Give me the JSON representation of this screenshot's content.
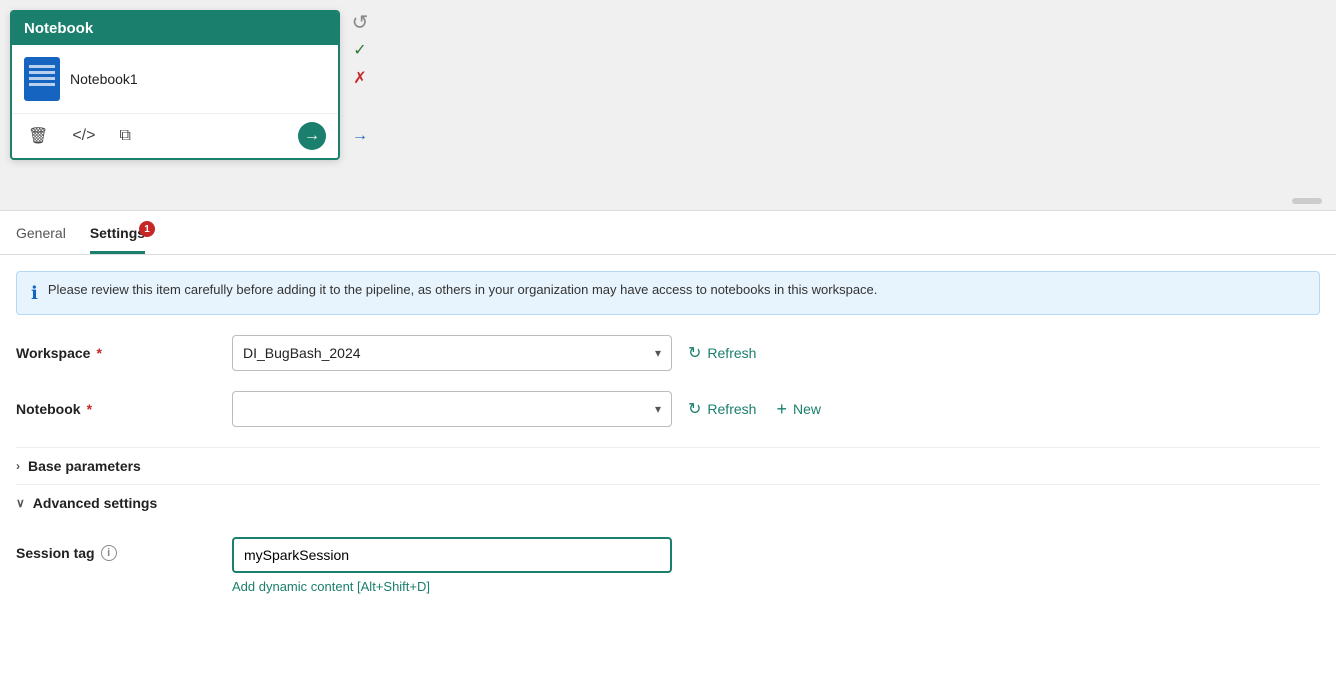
{
  "canvas": {
    "node": {
      "title": "Notebook",
      "name": "Notebook1",
      "actions": {
        "delete_label": "🗑",
        "code_label": "</>",
        "copy_label": "⧉",
        "go_label": "→"
      }
    }
  },
  "sidebar": {
    "undo_icon": "↺",
    "check_icon": "✓",
    "cross_icon": "✗",
    "arrow_right_icon": "→"
  },
  "tabs": {
    "general_label": "General",
    "settings_label": "Settings",
    "settings_badge": "1"
  },
  "info_banner": {
    "text": "Please review this item carefully before adding it to the pipeline, as others in your organization may have access to notebooks in this workspace."
  },
  "form": {
    "workspace_label": "Workspace",
    "workspace_value": "DI_BugBash_2024",
    "notebook_label": "Notebook",
    "notebook_value": "",
    "notebook_placeholder": "",
    "refresh_label_1": "Refresh",
    "refresh_label_2": "Refresh",
    "new_label": "New",
    "base_params_label": "Base parameters",
    "advanced_settings_label": "Advanced settings",
    "session_tag_label": "Session tag",
    "session_tag_value": "mySparkSession",
    "session_tag_info": "i",
    "dynamic_content_label": "Add dynamic content [Alt+Shift+D]"
  }
}
